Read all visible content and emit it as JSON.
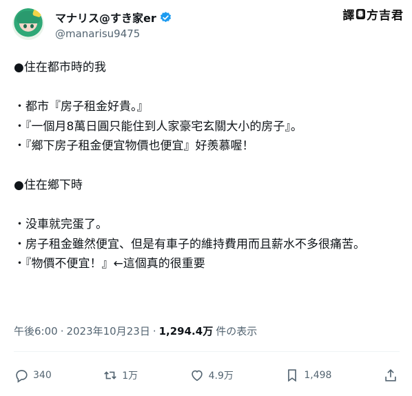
{
  "author": {
    "display_name": "マナリス@すき家er",
    "handle": "@manarisu9475",
    "verified": true
  },
  "watermark": {
    "prefix": "譯",
    "badge": "8",
    "name": "方吉君"
  },
  "tweet": {
    "text": "●住在都市時的我\n\n・都市『房子租金好貴。』\n・『一個月8萬日圓只能住到人家豪宅玄關大小的房子』。\n・『鄉下房子租金便宜物價也便宜』好羨慕喔！\n\n●住在鄉下時\n\n・没車就完蛋了。\n・房子租金雖然便宜、但是有車子的維持費用而且薪水不多很痛苦。\n・『物價不便宜！』←這個真的很重要"
  },
  "meta": {
    "time": "午後6:00",
    "sep1": "·",
    "date": "2023年10月23日",
    "sep2": "·",
    "views": "1,294.4万",
    "views_label": "件の表示"
  },
  "actions": {
    "replies": "340",
    "reposts": "1万",
    "likes": "4.9万",
    "bookmarks": "1,498"
  },
  "colors": {
    "text": "#0f1419",
    "secondary": "#536471",
    "verified": "#1d9bf0"
  }
}
